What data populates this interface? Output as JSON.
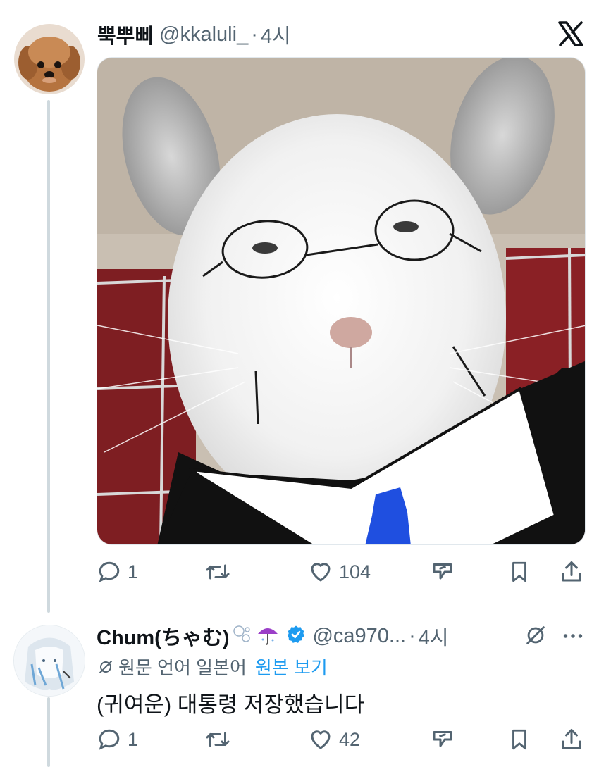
{
  "tweet": {
    "author_name": "뿍뿌삐",
    "handle": "@kkaluli_",
    "separator": "·",
    "time": "4시",
    "actions": {
      "replies": "1",
      "likes": "104"
    }
  },
  "reply": {
    "author_name": "Chum(ちゃむ)",
    "handle": "@ca970...",
    "separator": "·",
    "time": "4시",
    "translate_note": "원문 언어 일본어",
    "translate_link": "원본 보기",
    "text": "(귀여운) 대통령 저장했습니다",
    "actions": {
      "replies": "1",
      "likes": "42"
    }
  },
  "colors": {
    "verified": "#1d9bf0",
    "link": "#1d9bf0",
    "muted": "#536471",
    "tie": "#1f4fe0"
  },
  "icons": [
    "x-logo-icon",
    "reply-icon",
    "retweet-icon",
    "heart-icon",
    "grok-icon",
    "bookmark-icon",
    "share-icon",
    "verified-badge-icon",
    "bubbles-icon",
    "umbrella-icon",
    "translate-icon",
    "more-icon"
  ]
}
